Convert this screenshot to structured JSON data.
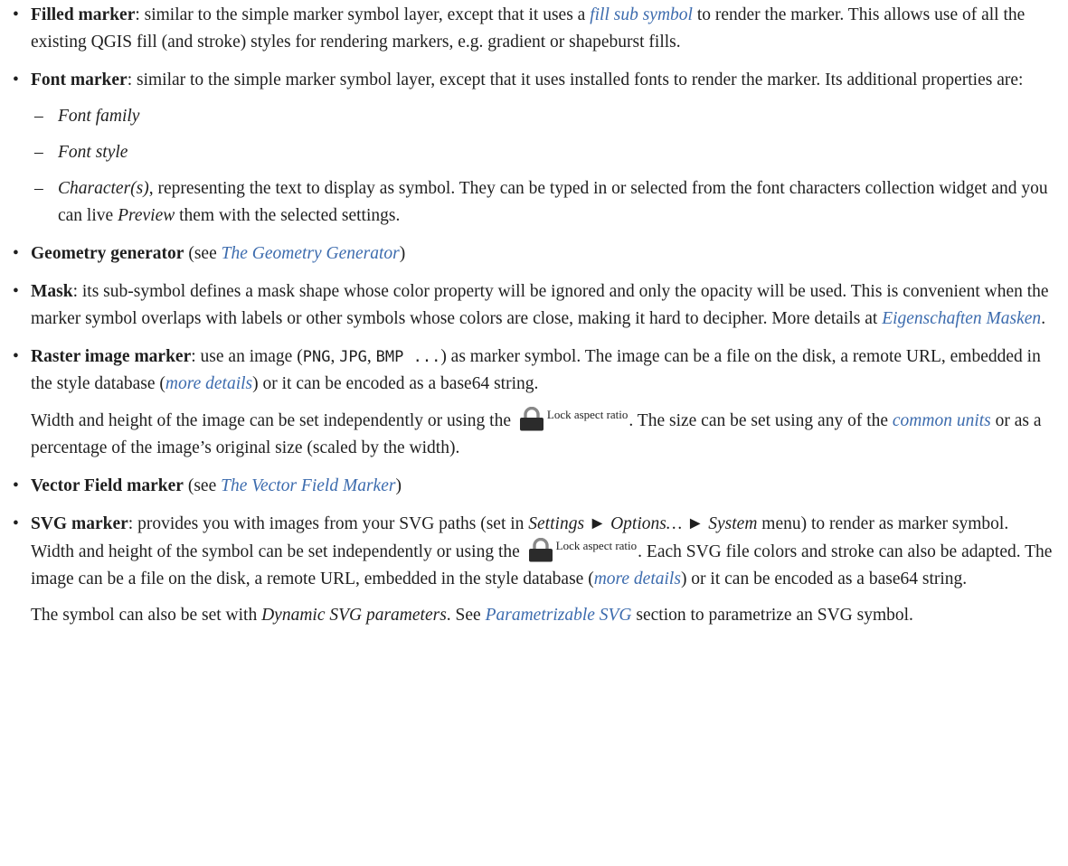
{
  "bullet": "•",
  "dash": "–",
  "items": {
    "filled": {
      "title": "Filled marker",
      "t1": ": similar to the simple marker symbol layer, except that it uses a ",
      "link": "fill sub symbol",
      "t2": " to render the marker. This allows use of all the existing QGIS fill (and stroke) styles for rendering markers, e.g. gradient or shapeburst fills."
    },
    "font": {
      "title": "Font marker",
      "t1": ": similar to the simple marker symbol layer, except that it uses installed fonts to render the marker. Its additional properties are:",
      "sub1": "Font family",
      "sub2": "Font style",
      "sub3_em": "Character(s)",
      "sub3_t1": ", representing the text to display as symbol. They can be typed in or selected from the font characters collection widget and you can live ",
      "sub3_em2": "Preview",
      "sub3_t2": " them with the selected settings."
    },
    "geometry": {
      "title": "Geometry generator",
      "t1": " (see ",
      "link": "The Geometry Generator",
      "t2": ")"
    },
    "mask": {
      "title": "Mask",
      "t1": ": its sub-symbol defines a mask shape whose color property will be ignored and only the opacity will be used. This is convenient when the marker symbol overlaps with labels or other symbols whose colors are close, making it hard to decipher. More details at ",
      "link": "Eigenschaften Masken",
      "t2": "."
    },
    "raster": {
      "title": "Raster image marker",
      "t1": ": use an image (",
      "code1": "PNG",
      "c1": ", ",
      "code2": "JPG",
      "c2": ", ",
      "code3": "BMP ...",
      "t2": ") as marker symbol. The image can be a file on the disk, a remote URL, embedded in the style database (",
      "link1": "more details",
      "t3": ") or it can be encoded as a base64 string.",
      "p2_t1": "Width and height of the image can be set independently or using the ",
      "lock_label": "Lock aspect ratio",
      "p2_t2": ". The size can be set using any of the ",
      "link2": "common units",
      "p2_t3": " or as a percentage of the image’s original size (scaled by the width)."
    },
    "vector": {
      "title": "Vector Field marker",
      "t1": " (see ",
      "link": "The Vector Field Marker",
      "t2": ")"
    },
    "svg": {
      "title": "SVG marker",
      "t1": ": provides you with images from your SVG paths (set in ",
      "m1": "Settings",
      "arrow1": " ► ",
      "m2": "Options…",
      "arrow2": " ► ",
      "m3": "System",
      "t2": " menu) to render as marker symbol. Width and height of the symbol can be set independently or using the ",
      "lock_label": "Lock aspect ratio",
      "t3": ". Each SVG file colors and stroke can also be adapted. The image can be a file on the disk, a remote URL, embedded in the style database (",
      "link1": "more details",
      "t4": ") or it can be encoded as a base64 string.",
      "p2_t1": "The symbol can also be set with ",
      "p2_em": "Dynamic SVG parameters",
      "p2_t2": ". See ",
      "link2": "Parametrizable SVG",
      "p2_t3": " section to parametrize an SVG symbol."
    }
  }
}
